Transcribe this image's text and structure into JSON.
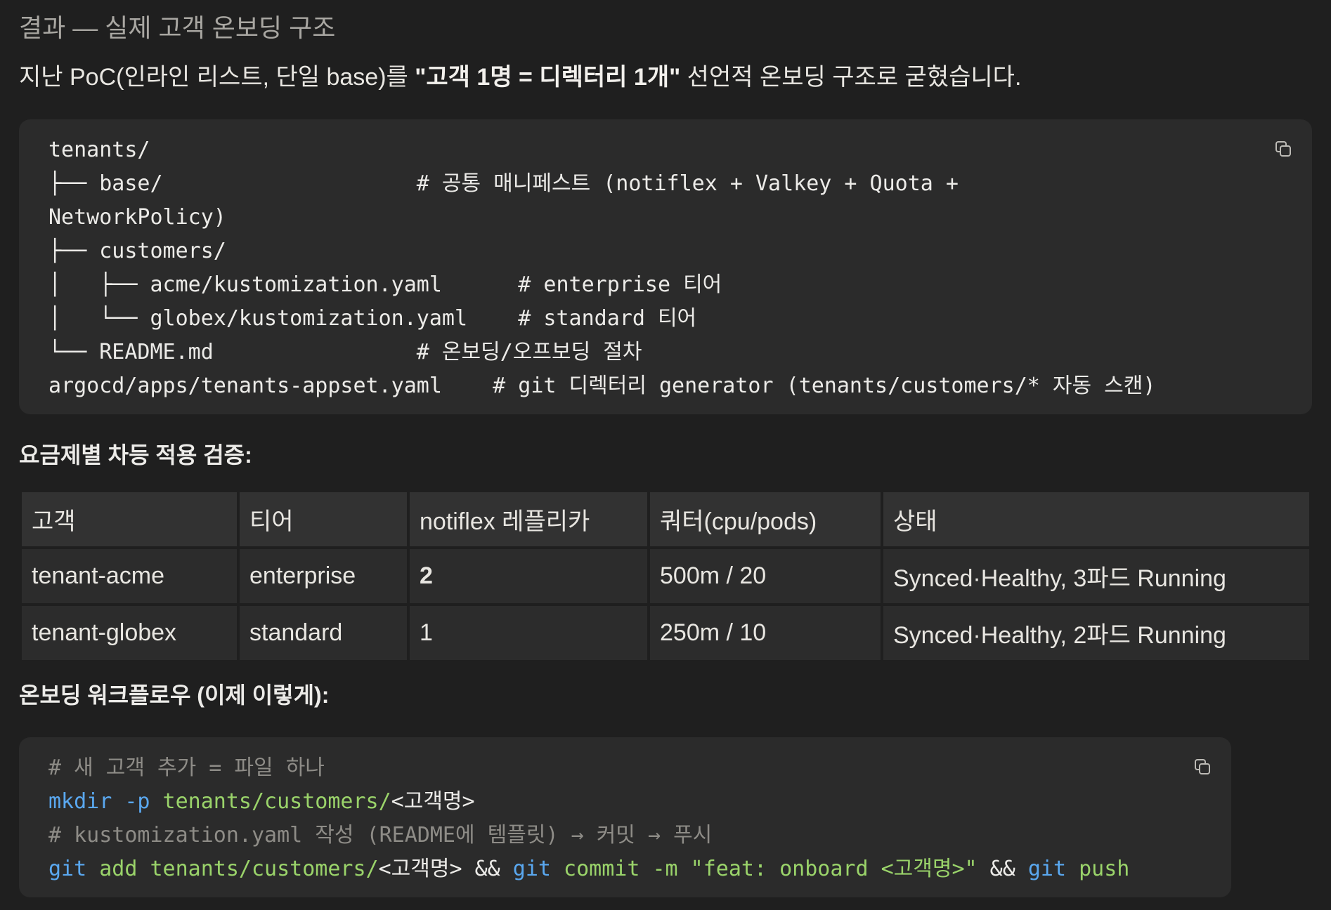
{
  "heading": "결과 — 실제 고객 온보딩 구조",
  "intro": {
    "before": "지난 PoC(인라인 리스트, 단일 base)를 ",
    "bold": "\"고객 1명 = 디렉터리 1개\"",
    "after": " 선언적 온보딩 구조로 굳혔습니다."
  },
  "tree_code": [
    "tenants/",
    "├── base/                    # 공통 매니페스트 (notiflex + Valkey + Quota +",
    "NetworkPolicy)",
    "├── customers/",
    "│   ├── acme/kustomization.yaml      # enterprise 티어",
    "│   └── globex/kustomization.yaml    # standard 티어",
    "└── README.md                # 온보딩/오프보딩 절차",
    "argocd/apps/tenants-appset.yaml    # git 디렉터리 generator (tenants/customers/* 자동 스캔)"
  ],
  "section1_title": "요금제별 차등 적용 검증:",
  "table": {
    "headers": [
      "고객",
      "티어",
      "notiflex 레플리카",
      "쿼터(cpu/pods)",
      "상태"
    ],
    "rows": [
      [
        "tenant-acme",
        "enterprise",
        "2",
        "500m / 20",
        "Synced·Healthy, 3파드 Running"
      ],
      [
        "tenant-globex",
        "standard",
        "1",
        "250m / 10",
        "Synced·Healthy, 2파드 Running"
      ]
    ]
  },
  "section2_title": "온보딩 워크플로우 (이제 이렇게):",
  "workflow_code": {
    "line1": "# 새 고객 추가 = 파일 하나",
    "line2": {
      "cmd": "mkdir",
      "flag": " -p",
      "path": " tenants/customers/",
      "rest": "<고객명>"
    },
    "line3": "# kustomization.yaml 작성 (README에 템플릿) → 커밋 → 푸시",
    "line4": {
      "git1": "git",
      "add": " add",
      "path": " tenants/customers/",
      "rest1": "<고객명>",
      "and1": " && ",
      "git2": "git",
      "commit": " commit -m",
      "msg": " \"feat: onboard <고객명>\"",
      "and2": " && ",
      "git3": "git",
      "push": " push"
    }
  },
  "icons": {
    "copy": "copy-icon"
  }
}
